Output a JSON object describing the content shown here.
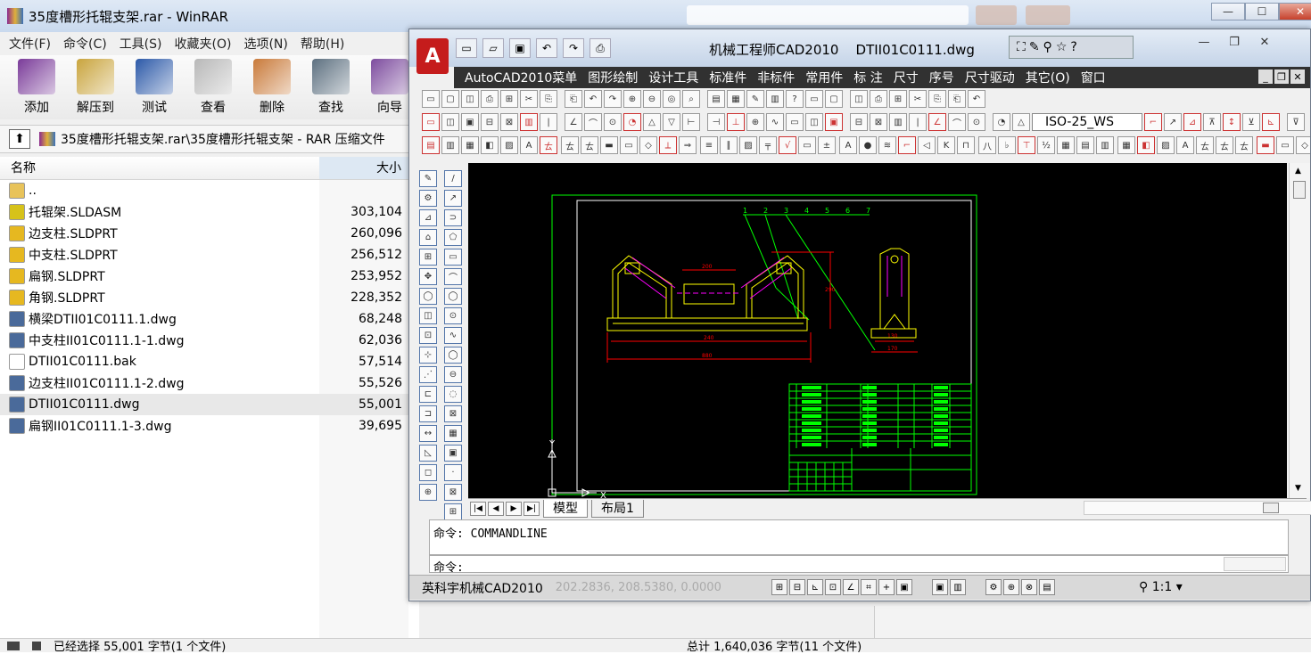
{
  "winrar": {
    "title": "35度槽形托辊支架.rar - WinRAR",
    "menu": [
      "文件(F)",
      "命令(C)",
      "工具(S)",
      "收藏夹(O)",
      "选项(N)",
      "帮助(H)"
    ],
    "toolbar": [
      {
        "label": "添加",
        "icon": "add-archive-icon",
        "color": "#7a3b99"
      },
      {
        "label": "解压到",
        "icon": "extract-to-icon",
        "color": "#c9a43d"
      },
      {
        "label": "测试",
        "icon": "test-icon",
        "color": "#2c59a8"
      },
      {
        "label": "查看",
        "icon": "view-icon",
        "color": "#b8b8b8"
      },
      {
        "label": "删除",
        "icon": "delete-icon",
        "color": "#c97a3a"
      },
      {
        "label": "查找",
        "icon": "find-icon",
        "color": "#5d7080"
      },
      {
        "label": "向导",
        "icon": "wizard-icon",
        "color": "#7d4c9e"
      }
    ],
    "path": "35度槽形托辊支架.rar\\35度槽形托辊支架 - RAR 压缩文件",
    "columns": {
      "name": "名称",
      "size": "大小"
    },
    "files": [
      {
        "name": "..",
        "size": "",
        "icon": "folder-up-icon",
        "color": "#e8c35a"
      },
      {
        "name": "托辊架.SLDASM",
        "size": "303,104",
        "icon": "sldasm-icon",
        "color": "#d6c21a"
      },
      {
        "name": "边支柱.SLDPRT",
        "size": "260,096",
        "icon": "sldprt-icon",
        "color": "#e6b820"
      },
      {
        "name": "中支柱.SLDPRT",
        "size": "256,512",
        "icon": "sldprt-icon",
        "color": "#e6b820"
      },
      {
        "name": "扁钢.SLDPRT",
        "size": "253,952",
        "icon": "sldprt-icon",
        "color": "#e6b820"
      },
      {
        "name": "角钢.SLDPRT",
        "size": "228,352",
        "icon": "sldprt-icon",
        "color": "#e6b820"
      },
      {
        "name": "横梁DTII01C0111.1.dwg",
        "size": "68,248",
        "icon": "dwg-icon",
        "color": "#4a6a9a"
      },
      {
        "name": "中支柱II01C0111.1-1.dwg",
        "size": "62,036",
        "icon": "dwg-icon",
        "color": "#4a6a9a"
      },
      {
        "name": "DTII01C0111.bak",
        "size": "57,514",
        "icon": "file-icon",
        "color": "#ffffff"
      },
      {
        "name": "边支柱II01C0111.1-2.dwg",
        "size": "55,526",
        "icon": "dwg-icon",
        "color": "#4a6a9a"
      },
      {
        "name": "DTII01C0111.dwg",
        "size": "55,001",
        "icon": "dwg-icon",
        "color": "#4a6a9a",
        "selected": true
      },
      {
        "name": "扁钢II01C0111.1-3.dwg",
        "size": "39,695",
        "icon": "dwg-icon",
        "color": "#4a6a9a"
      }
    ],
    "status_left": "已经选择 55,001 字节(1 个文件)",
    "status_right": "总计 1,640,036 字节(11 个文件)"
  },
  "acad": {
    "app_title": "机械工程师CAD2010",
    "doc_title": "DTII01C0111.dwg",
    "logo": "A",
    "menu": [
      "AutoCAD2010菜单",
      "图形绘制",
      "设计工具",
      "标准件",
      "非标件",
      "常用件",
      "标 注",
      "尺寸",
      "序号",
      "尺寸驱动",
      "其它(O)",
      "窗口"
    ],
    "dim_style": "ISO-25_WS",
    "layout_tabs": [
      "模型",
      "布局1"
    ],
    "command_history": "命令: COMMANDLINE",
    "command_prompt": "命令:",
    "app_name": "英科宇机械CAD2010",
    "coords": "202.2836,  208.5380,  0.0000",
    "scale": "1:1",
    "balloons": [
      "1",
      "2",
      "3",
      "4",
      "5",
      "6",
      "7"
    ],
    "dims": {
      "top": "200",
      "mid": "240",
      "bottom": "880",
      "side_h": "290",
      "right_a": "130",
      "right_b": "170"
    },
    "colors": {
      "border": "#00ff00",
      "part": "#ffff00",
      "dim": "#ff0000",
      "balloon": "#00ff00",
      "table": "#00ff00",
      "cyan": "#00ffff",
      "magenta": "#ff00ff"
    }
  }
}
